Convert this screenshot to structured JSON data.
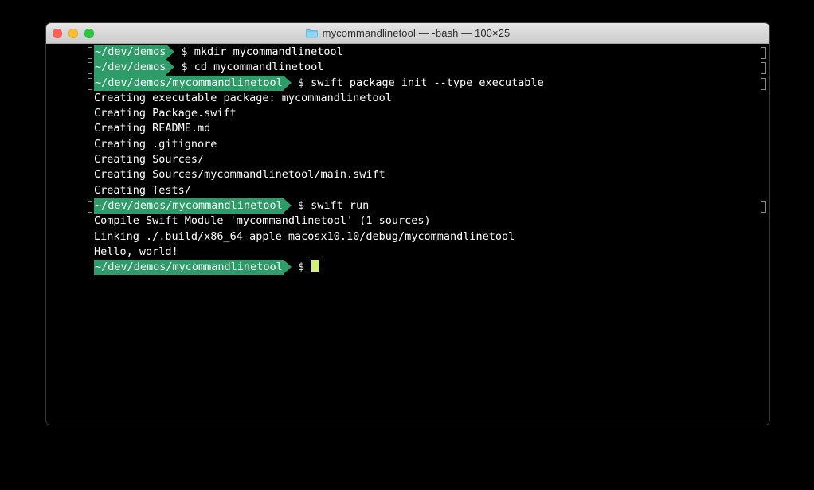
{
  "window": {
    "title": "mycommandlinetool — -bash — 100×25",
    "folder_icon": "folder-icon",
    "traffic_lights": {
      "close": "close-button",
      "minimize": "minimize-button",
      "maximize": "maximize-button"
    },
    "columns": 100,
    "rows": 25
  },
  "theme": {
    "background": "#000000",
    "foreground": "#ffffff",
    "prompt_background": "#2e9c69",
    "prompt_foreground": "#ffffff",
    "cursor": "#d3ee7e",
    "titlebar_background": "#d8d8d8",
    "titlebar_text": "#2e2e2e",
    "mark_bracket": "#8a8a8a",
    "traffic_red": "#ff5f57",
    "traffic_yellow": "#febc2e",
    "traffic_green": "#28c840",
    "folder_blue": "#6fc5f0"
  },
  "terminal": {
    "lines": [
      {
        "type": "prompt",
        "mark": true,
        "path": "~/dev/demos",
        "sigil": "$",
        "command": "mkdir mycommandlinetool"
      },
      {
        "type": "prompt",
        "mark": true,
        "path": "~/dev/demos",
        "sigil": "$",
        "command": "cd mycommandlinetool"
      },
      {
        "type": "prompt",
        "mark": true,
        "path": "~/dev/demos/mycommandlinetool",
        "sigil": "$",
        "command": "swift package init --type executable"
      },
      {
        "type": "output",
        "text": "Creating executable package: mycommandlinetool"
      },
      {
        "type": "output",
        "text": "Creating Package.swift"
      },
      {
        "type": "output",
        "text": "Creating README.md"
      },
      {
        "type": "output",
        "text": "Creating .gitignore"
      },
      {
        "type": "output",
        "text": "Creating Sources/"
      },
      {
        "type": "output",
        "text": "Creating Sources/mycommandlinetool/main.swift"
      },
      {
        "type": "output",
        "text": "Creating Tests/"
      },
      {
        "type": "prompt",
        "mark": true,
        "path": "~/dev/demos/mycommandlinetool",
        "sigil": "$",
        "command": "swift run"
      },
      {
        "type": "output",
        "text": "Compile Swift Module 'mycommandlinetool' (1 sources)"
      },
      {
        "type": "output",
        "text": "Linking ./.build/x86_64-apple-macosx10.10/debug/mycommandlinetool"
      },
      {
        "type": "output",
        "text": "Hello, world!"
      },
      {
        "type": "prompt",
        "mark": false,
        "path": "~/dev/demos/mycommandlinetool",
        "sigil": "$",
        "command": "",
        "cursor": true
      }
    ]
  }
}
